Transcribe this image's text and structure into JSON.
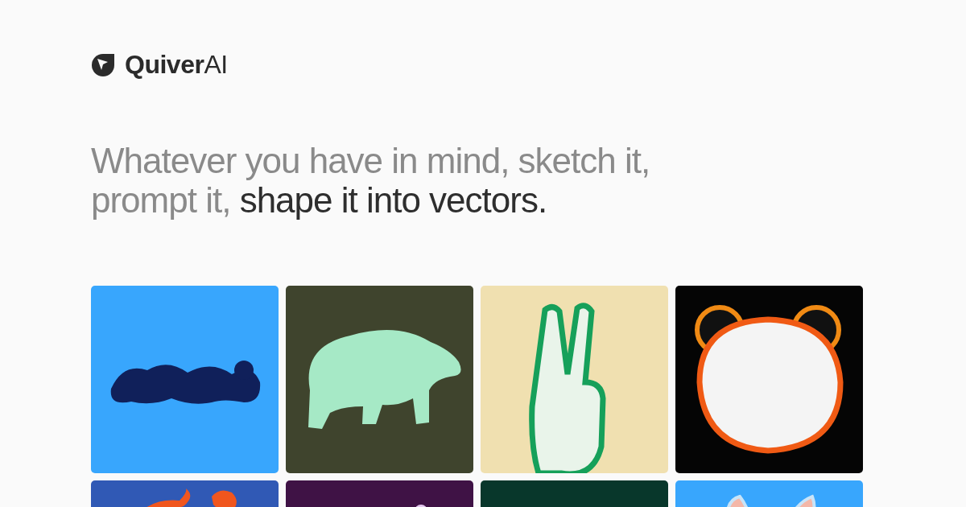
{
  "brand": {
    "name": "**Quiver**AI"
  },
  "headline": "Whatever you have in mind, sketch it, prompt it, **shape it into vectors.**"
}
